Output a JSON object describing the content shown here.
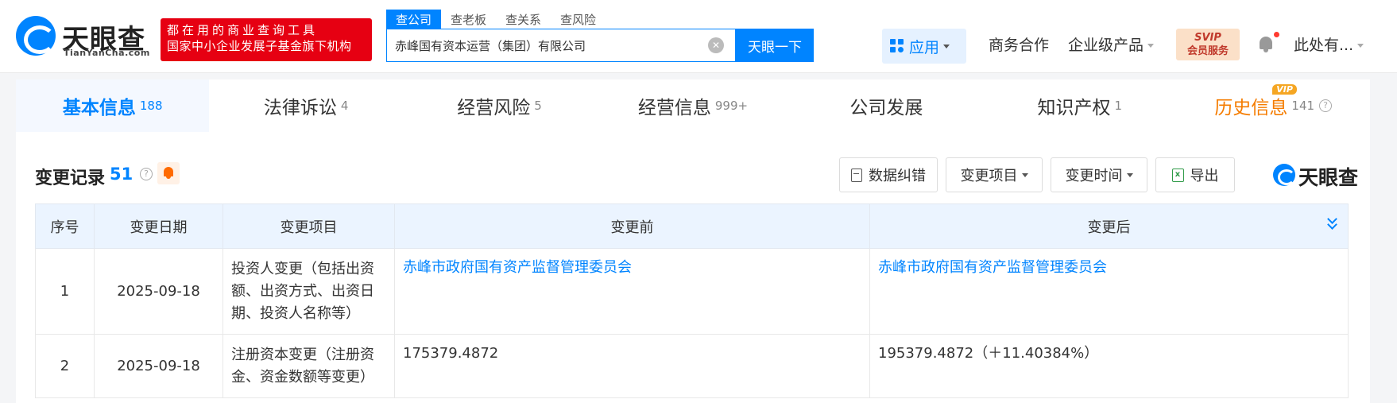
{
  "header": {
    "logo_text": "天眼查",
    "logo_sub": "TianYanCha.com",
    "slogan_line1": "都在用的商业查询工具",
    "slogan_line2": "国家中小企业发展子基金旗下机构",
    "search_tabs": [
      "查公司",
      "查老板",
      "查关系",
      "查风险"
    ],
    "search_value": "赤峰国有资本运营（集团）有限公司",
    "search_button": "天眼一下",
    "nav": {
      "app": "应用",
      "business": "商务合作",
      "enterprise": "企业级产品",
      "svip_line1": "SVIP",
      "svip_line2": "会员服务",
      "user": "此处有..."
    }
  },
  "tabs": [
    {
      "label": "基本信息",
      "count": "188"
    },
    {
      "label": "法律诉讼",
      "count": "4"
    },
    {
      "label": "经营风险",
      "count": "5"
    },
    {
      "label": "经营信息",
      "count": "999+"
    },
    {
      "label": "公司发展",
      "count": ""
    },
    {
      "label": "知识产权",
      "count": "1"
    },
    {
      "label": "历史信息",
      "count": "141",
      "badge": "VIP"
    }
  ],
  "section": {
    "title": "变更记录",
    "count": "51",
    "buttons": {
      "correction": "数据纠错",
      "change_item": "变更项目",
      "change_time": "变更时间",
      "export": "导出"
    },
    "brand": "天眼查"
  },
  "table": {
    "headers": [
      "序号",
      "变更日期",
      "变更项目",
      "变更前",
      "变更后"
    ],
    "rows": [
      {
        "index": "1",
        "date": "2025-09-18",
        "item": "投资人变更（包括出资额、出资方式、出资日期、投资人名称等）",
        "before": "赤峰市政府国有资产监督管理委员会",
        "after": "赤峰市政府国有资产监督管理委员会"
      },
      {
        "index": "2",
        "date": "2025-09-18",
        "item": "注册资本变更（注册资金、资金数额等变更）",
        "before": "175379.4872",
        "after": "195379.4872（＋11.40384%）"
      }
    ]
  },
  "colors": {
    "brand_blue": "#0084ff",
    "slogan_red": "#e60012",
    "history_orange": "#f57c00",
    "increase_red": "#f04134"
  }
}
